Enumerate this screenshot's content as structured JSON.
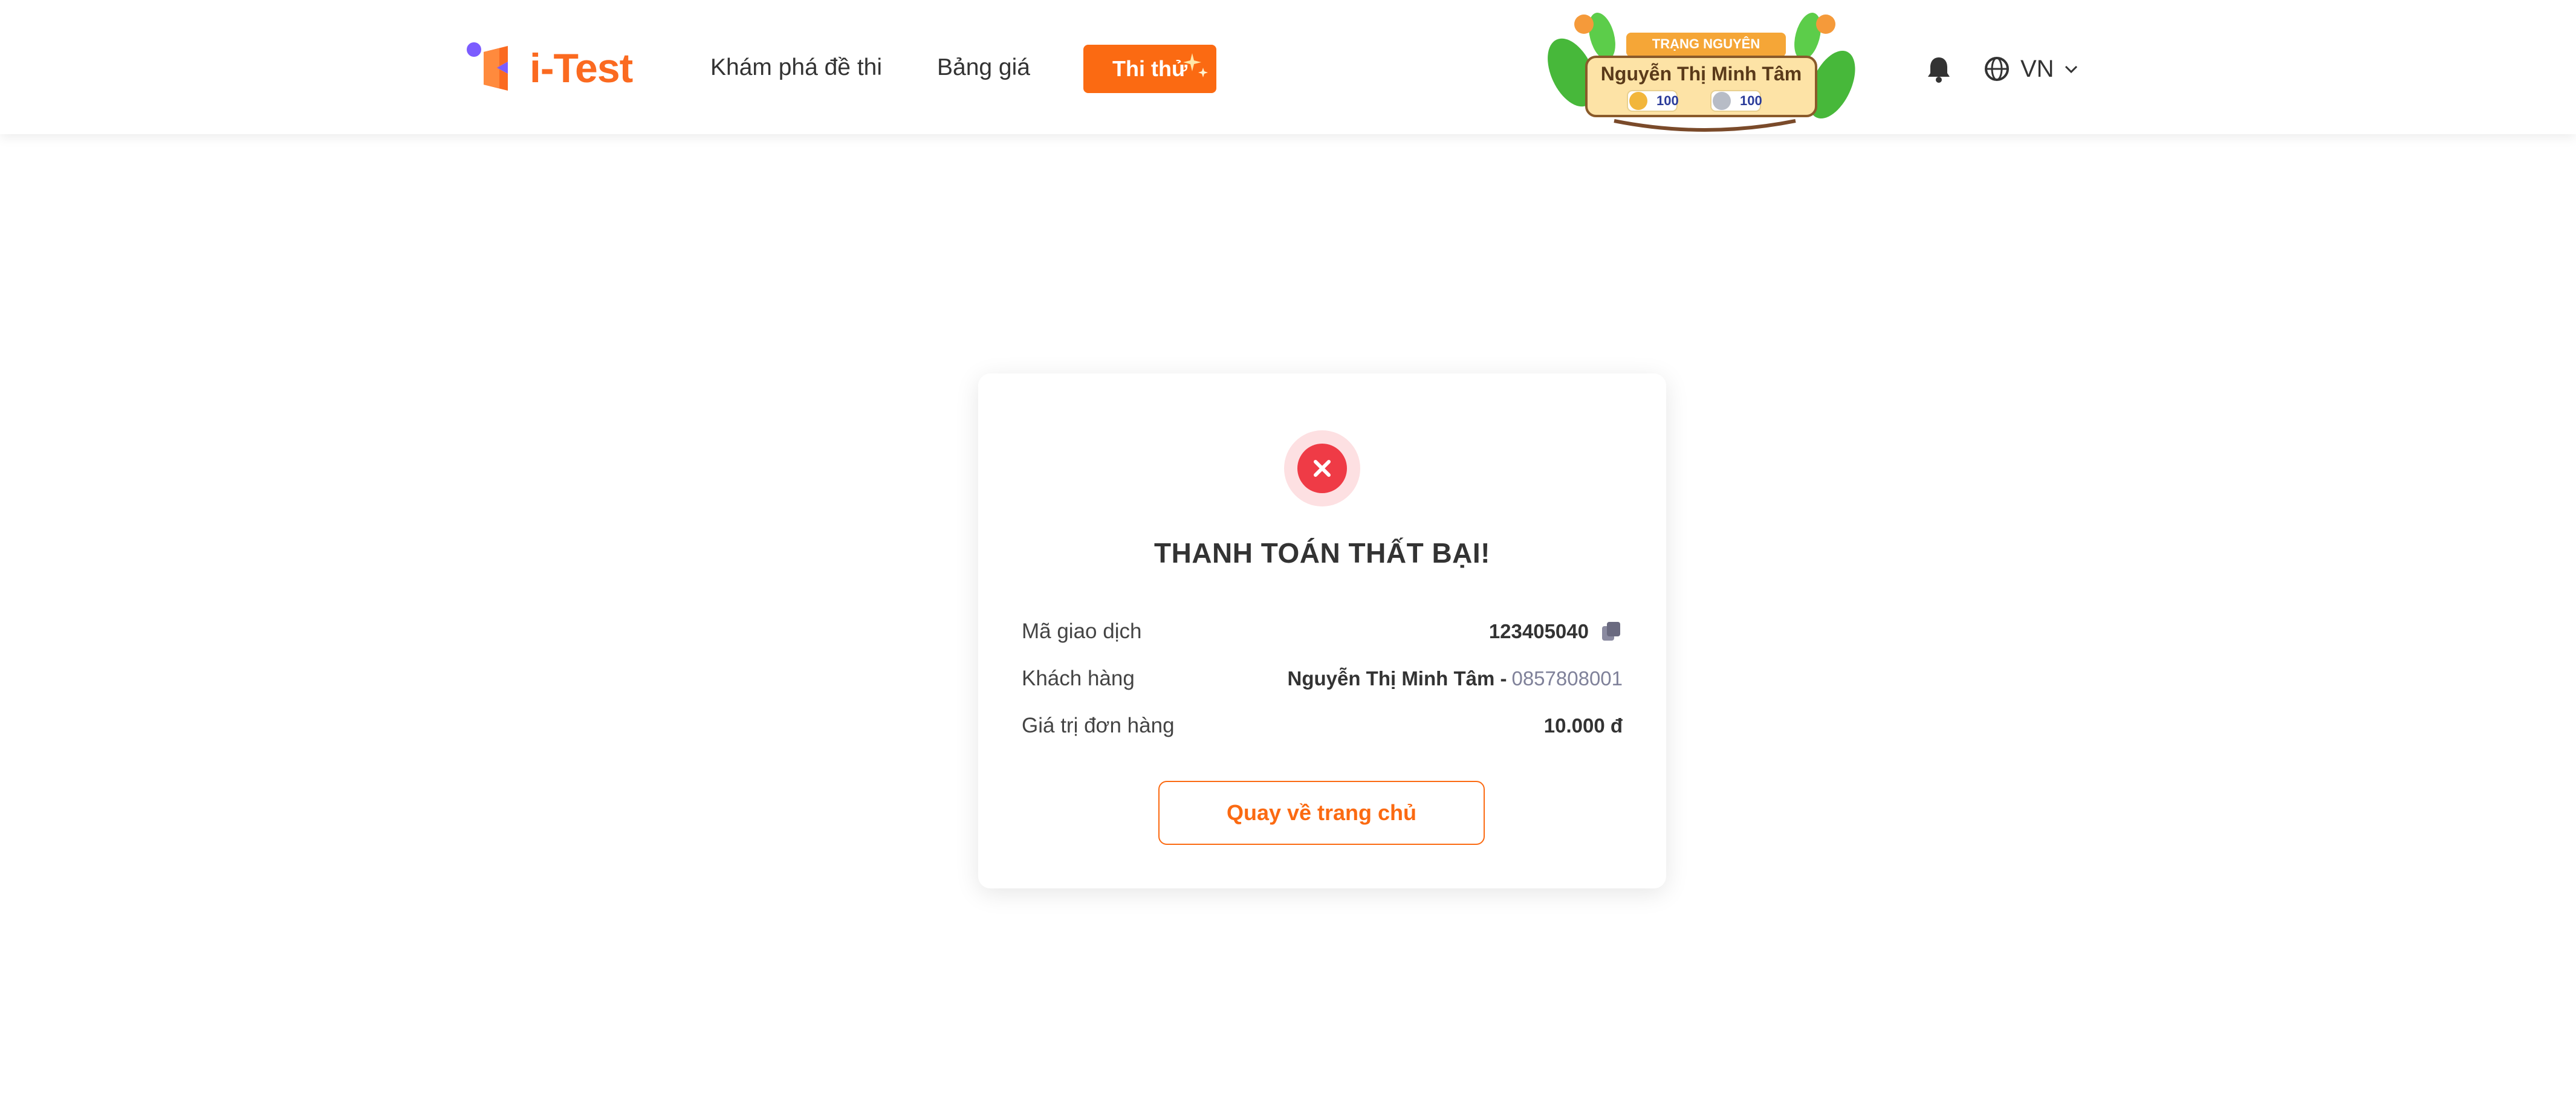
{
  "header": {
    "logo_text": "i-Test",
    "nav": {
      "explore": "Khám phá đề thi",
      "pricing": "Bảng giá",
      "trial": "Thi thử"
    },
    "badge": {
      "rank": "TRẠNG NGUYÊN",
      "user_name": "Nguyễn Thị Minh Tâm",
      "gold_coins": "100",
      "silver_coins": "100"
    },
    "language": "VN"
  },
  "result": {
    "title": "THANH TOÁN THẤT BẠI!",
    "rows": [
      {
        "label": "Mã giao dịch",
        "value": "123405040"
      },
      {
        "label": "Khách hàng",
        "value": "Nguyễn Thị Minh Tâm -",
        "phone": "0857808001"
      },
      {
        "label": "Giá trị đơn hàng",
        "value": "10.000 đ"
      }
    ],
    "back_button": "Quay về trang chủ"
  },
  "colors": {
    "brand_orange": "#fb6a12",
    "error_red": "#ef3b46",
    "error_halo": "#fde0e2",
    "logo_purple": "#7b5cff"
  },
  "icons": [
    "logo-mark-icon",
    "sparkle-icon",
    "bell-icon",
    "globe-icon",
    "chevron-down-icon",
    "close-icon",
    "copy-icon"
  ]
}
